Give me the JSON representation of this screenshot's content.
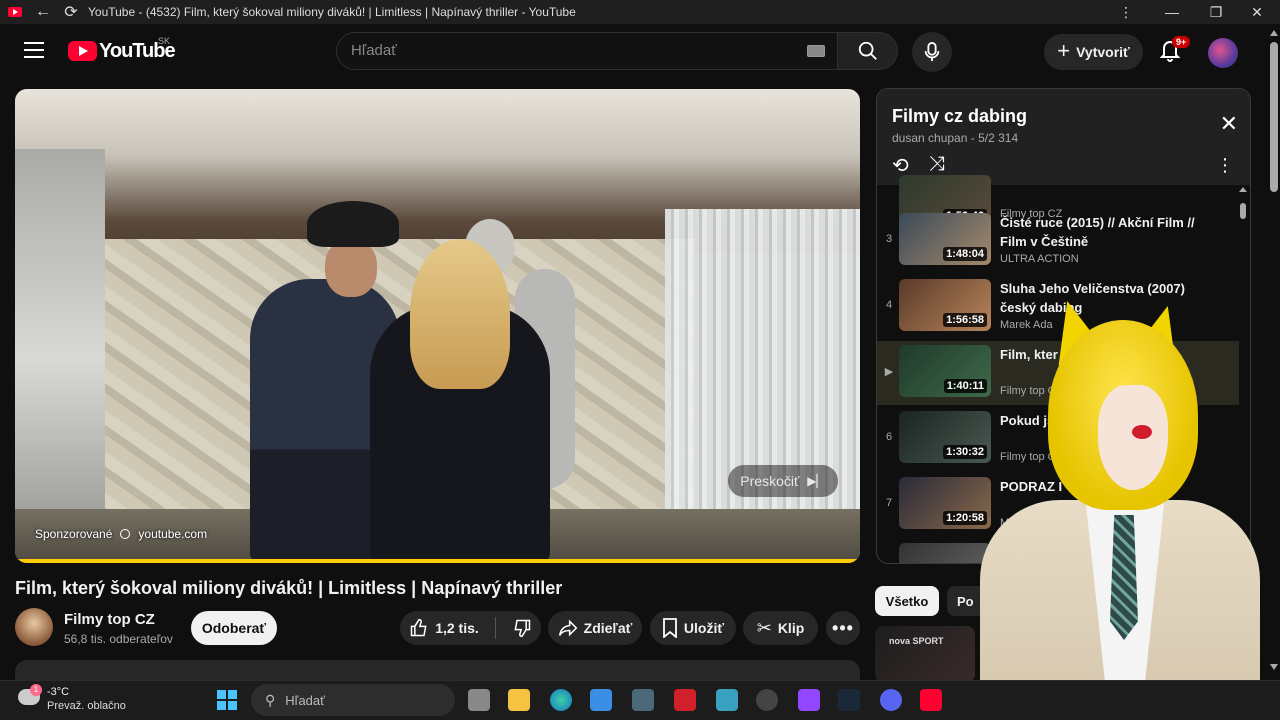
{
  "window": {
    "title": "YouTube - (4532) Film, který šokoval miliony diváků! | Limitless | Napínavý thriller - YouTube"
  },
  "masthead": {
    "logo_text": "YouTube",
    "country_code": "SK",
    "search_placeholder": "Hľadať",
    "create_label": "Vytvoriť",
    "notifications_badge": "9+"
  },
  "player": {
    "skip_label": "Preskočiť",
    "ad_label": "Sponzorované",
    "ad_domain": "youtube.com"
  },
  "video": {
    "title": "Film, který šokoval miliony diváků! | Limitless | Napínavý thriller",
    "channel_name": "Filmy top CZ",
    "subscribers": "56,8 tis. odberateľov",
    "subscribe_label": "Odoberať",
    "likes": "1,2 tis.",
    "share_label": "Zdieľať",
    "save_label": "Uložiť",
    "clip_label": "Klip"
  },
  "playlist": {
    "title": "Filmy cz dabing",
    "owner": "dusan chupan",
    "position": "5/2 314",
    "items": [
      {
        "index": "",
        "duration": "1:50:46",
        "title": "",
        "channel": "Filmy top CZ"
      },
      {
        "index": "3",
        "duration": "1:48:04",
        "title": "Čisté ruce (2015) // Akční Film // Film v Češtině",
        "channel": "ULTRA ACTION"
      },
      {
        "index": "4",
        "duration": "1:56:58",
        "title": "Sluha Jeho Veličenstva (2007) český dabing",
        "channel": "Marek Ada"
      },
      {
        "index": "▶",
        "duration": "1:40:11",
        "title": "Film, kter diváků! | Li",
        "channel": "Filmy top C"
      },
      {
        "index": "6",
        "duration": "1:30:32",
        "title": "Pokud jst horor – n",
        "channel": "Filmy top CZ"
      },
      {
        "index": "7",
        "duration": "1:20:58",
        "title": "PODRAZ I Če Akční, Dran",
        "channel": "MO"
      }
    ]
  },
  "chips": {
    "all": "Všetko",
    "second": "Po"
  },
  "recommendation": {
    "thumb_text": "nova SPORT"
  },
  "taskbar": {
    "weather_temp": "-3°C",
    "weather_desc": "Prevaž. oblačno",
    "weather_badge": "1",
    "search_placeholder": "Hľadať"
  },
  "colors": {
    "accent": "#ff0033",
    "progress": "#ffcc00",
    "background": "#0f0f0f"
  }
}
